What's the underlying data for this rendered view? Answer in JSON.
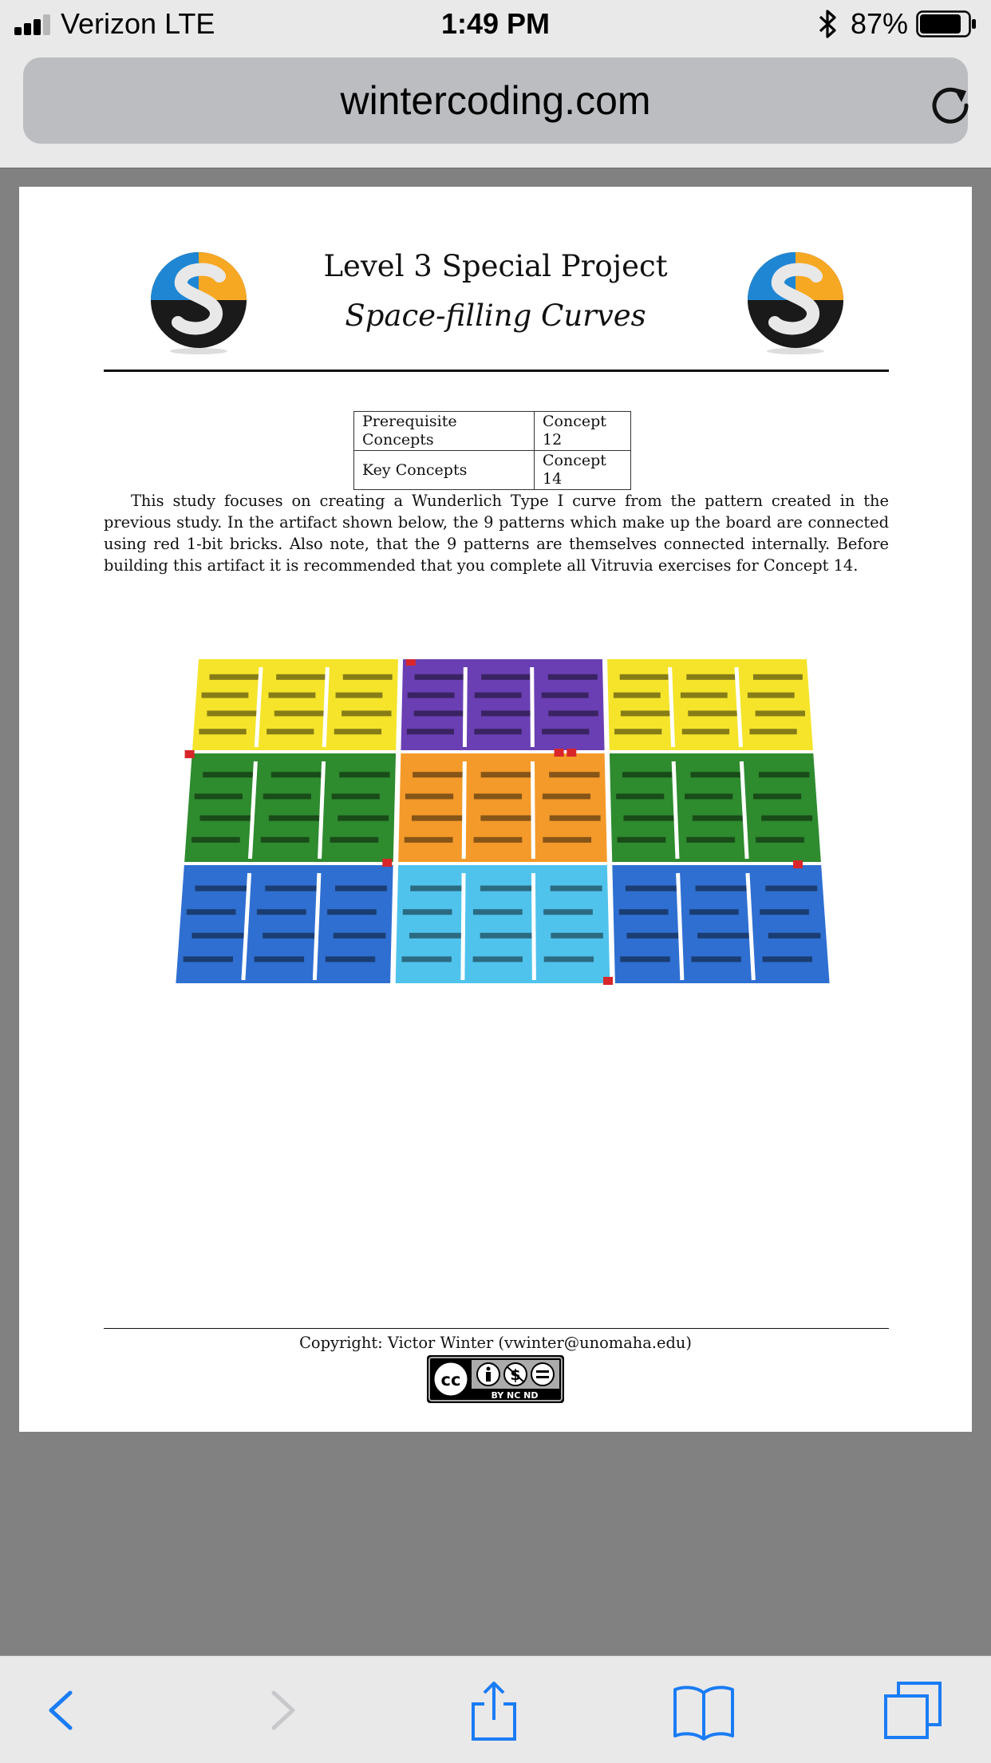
{
  "status_bar": {
    "carrier": "Verizon   LTE",
    "time": "1:49 PM",
    "battery_percent": "87%",
    "signal_bars": 3,
    "signal_total": 4,
    "battery_level": 0.87
  },
  "browser": {
    "url": "wintercoding.com",
    "reload_icon": "reload-icon",
    "toolbar_icons": [
      "back-chevron-icon",
      "forward-chevron-icon",
      "share-icon",
      "bookmarks-icon",
      "tabs-icon"
    ]
  },
  "document": {
    "title": "Level 3 Special Project",
    "subtitle": "Space-filling Curves",
    "concepts_table": [
      {
        "label": "Prerequisite Concepts",
        "value": "Concept 12"
      },
      {
        "label": "Key Concepts",
        "value": "Concept 14"
      }
    ],
    "paragraph": "This study focuses on creating a Wunderlich Type I curve from the pattern created in the previous study. In the artifact shown below, the 9 patterns which make up the board are connected using red 1-bit bricks. Also note, that the 9 patterns are themselves connected internally. Before building this artifact it is recommended that you complete all Vitruvia exercises for Concept 14.",
    "copyright": "Copyright: Victor Winter (vwinter@unomaha.edu)",
    "license_badge": "BY  NC  ND",
    "lego_colors": {
      "yellow": "#f5e42a",
      "purple": "#6a3fb3",
      "green": "#2e8b2e",
      "orange": "#f49a2a",
      "blue": "#2f6fd1",
      "light_blue": "#4fc3ec",
      "red_connector": "#d8262a"
    }
  }
}
